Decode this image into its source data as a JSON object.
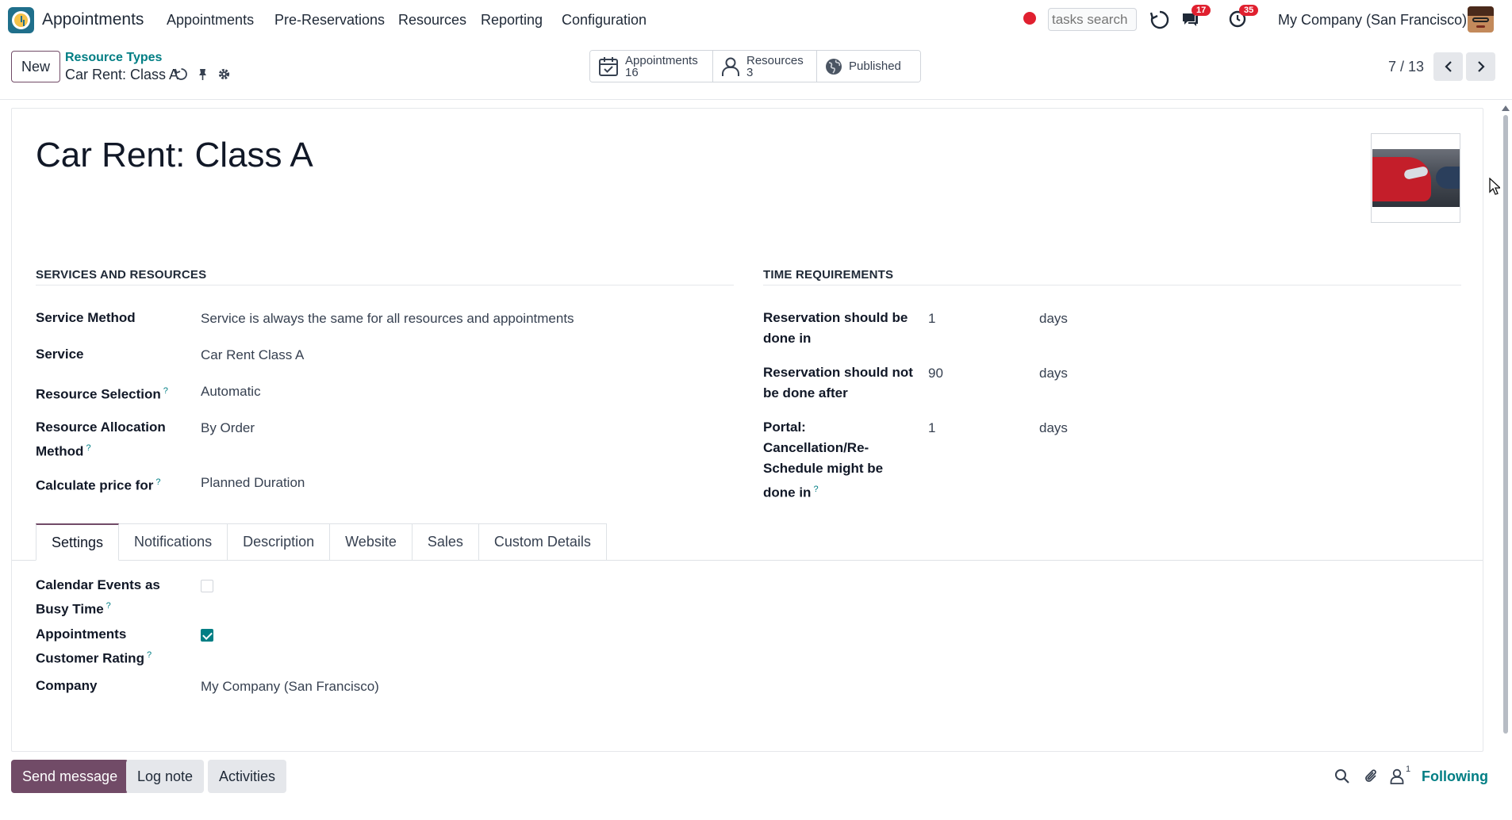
{
  "navbar": {
    "app_name": "Appointments",
    "menu": [
      "Appointments",
      "Pre-Reservations",
      "Resources",
      "Reporting",
      "Configuration"
    ],
    "search_placeholder": "tasks search",
    "messages_badge": "17",
    "activities_badge": "35",
    "company": "My Company (San Francisco)"
  },
  "control": {
    "new_label": "New",
    "breadcrumb_parent": "Resource Types",
    "breadcrumb_current": "Car Rent: Class A",
    "smart_buttons": {
      "appointments": {
        "label": "Appointments",
        "value": "16"
      },
      "resources": {
        "label": "Resources",
        "value": "3"
      },
      "published": {
        "label": "Published"
      }
    },
    "pager": "7 / 13"
  },
  "form": {
    "title": "Car Rent: Class A",
    "services_section": "SERVICES AND RESOURCES",
    "time_section": "TIME REQUIREMENTS",
    "fields": {
      "service_method": {
        "label": "Service Method",
        "value": "Service is always the same for all resources and appointments"
      },
      "service": {
        "label": "Service",
        "value": "Car Rent Class A"
      },
      "resource_selection": {
        "label": "Resource Selection",
        "value": "Automatic"
      },
      "allocation_method": {
        "label_line1": "Resource Allocation",
        "label_line2": "Method",
        "value": "By Order"
      },
      "calculate_price": {
        "label": "Calculate price for",
        "value": "Planned Duration"
      }
    },
    "time_fields": {
      "done_in": {
        "label_line1": "Reservation should be",
        "label_line2": "done in",
        "value": "1",
        "unit": "days"
      },
      "not_after": {
        "label_line1": "Reservation should not",
        "label_line2": "be done after",
        "value": "90",
        "unit": "days"
      },
      "portal": {
        "label_line1": "Portal:",
        "label_line2": "Cancellation/Re-",
        "label_line3": "Schedule might be",
        "label_line4": "done in",
        "value": "1",
        "unit": "days"
      }
    },
    "tabs": [
      "Settings",
      "Notifications",
      "Description",
      "Website",
      "Sales",
      "Custom Details"
    ],
    "settings": {
      "calendar_busy": {
        "label_line1": "Calendar Events as",
        "label_line2": "Busy Time",
        "checked": false
      },
      "customer_rating": {
        "label_line1": "Appointments",
        "label_line2": "Customer Rating",
        "checked": true
      },
      "company": {
        "label": "Company",
        "value": "My Company (San Francisco)"
      }
    },
    "help_mark": "?"
  },
  "chatter": {
    "send_message": "Send message",
    "log_note": "Log note",
    "activities": "Activities",
    "followers_count": "1",
    "following": "Following"
  },
  "colors": {
    "primary": "#714b67",
    "accent": "#017e84",
    "badge": "#e0202f"
  }
}
